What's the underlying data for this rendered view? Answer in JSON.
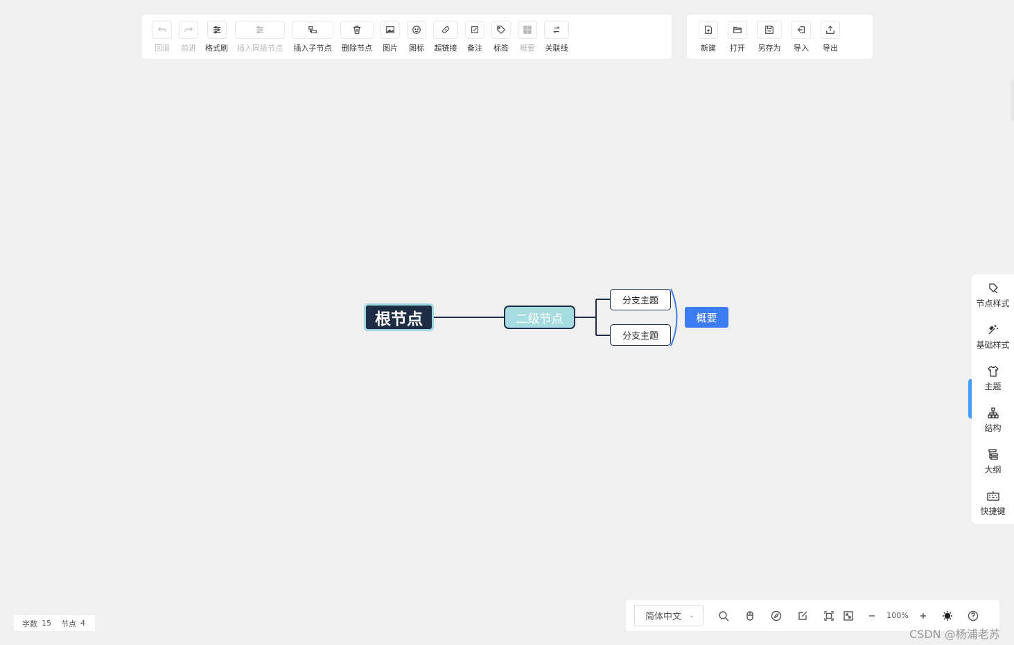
{
  "toolbar_main": [
    {
      "label": "回退",
      "icon": "undo-icon",
      "disabled": true
    },
    {
      "label": "前进",
      "icon": "redo-icon",
      "disabled": true
    },
    {
      "label": "格式刷",
      "icon": "format-brush-icon",
      "disabled": false
    },
    {
      "label": "插入同级节点",
      "icon": "insert-sibling-icon",
      "disabled": true
    },
    {
      "label": "插入子节点",
      "icon": "insert-child-icon",
      "disabled": false
    },
    {
      "label": "删除节点",
      "icon": "trash-icon",
      "disabled": false
    },
    {
      "label": "图片",
      "icon": "image-icon",
      "disabled": false
    },
    {
      "label": "图标",
      "icon": "smiley-icon",
      "disabled": false
    },
    {
      "label": "超链接",
      "icon": "link-icon",
      "disabled": false
    },
    {
      "label": "备注",
      "icon": "note-icon",
      "disabled": false
    },
    {
      "label": "标签",
      "icon": "tag-icon",
      "disabled": false
    },
    {
      "label": "概要",
      "icon": "summary-icon",
      "disabled": true
    },
    {
      "label": "关联线",
      "icon": "association-line-icon",
      "disabled": false
    }
  ],
  "toolbar_file": [
    {
      "label": "新建",
      "icon": "new-file-icon"
    },
    {
      "label": "打开",
      "icon": "open-folder-icon"
    },
    {
      "label": "另存为",
      "icon": "save-as-icon"
    },
    {
      "label": "导入",
      "icon": "import-icon"
    },
    {
      "label": "导出",
      "icon": "export-icon"
    }
  ],
  "mindmap": {
    "root": "根节点",
    "second": "二级节点",
    "branch_1": "分支主题",
    "branch_2": "分支主题",
    "summary": "概要"
  },
  "right_panel": [
    {
      "label": "节点样式",
      "icon": "node-style-icon"
    },
    {
      "label": "基础样式",
      "icon": "magic-wand-icon"
    },
    {
      "label": "主题",
      "icon": "shirt-icon"
    },
    {
      "label": "结构",
      "icon": "structure-icon"
    },
    {
      "label": "大纲",
      "icon": "outline-icon"
    },
    {
      "label": "快捷键",
      "icon": "keyboard-icon"
    }
  ],
  "status": {
    "word_count_label": "字数",
    "word_count": "15",
    "node_count_label": "节点",
    "node_count": "4"
  },
  "bottom_toolbar": {
    "language": "简体中文",
    "zoom": "100%"
  },
  "watermark": "CSDN @杨浦老苏",
  "colors": {
    "root_bg": "#1e2c46",
    "second_bg": "#a6dce0",
    "summary_bg": "#3c7cf0",
    "accent": "#409eff"
  }
}
